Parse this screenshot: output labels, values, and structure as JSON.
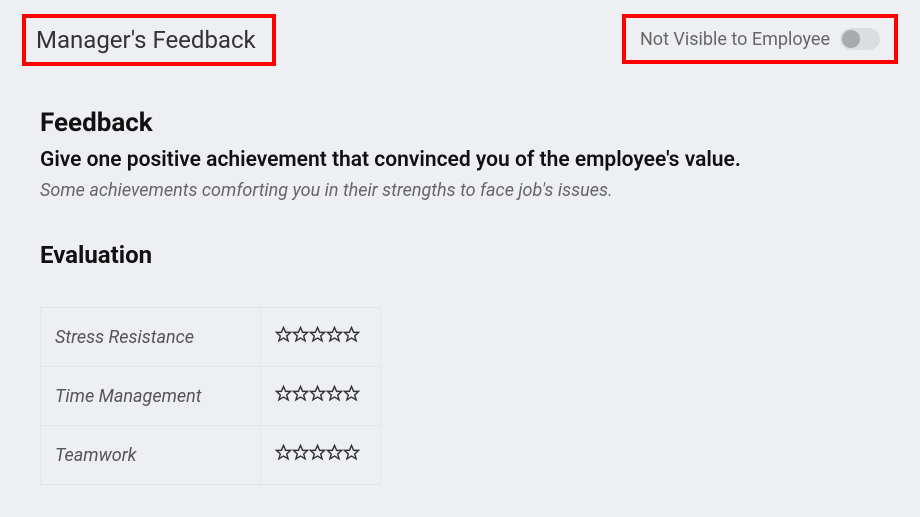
{
  "header": {
    "title": "Manager's Feedback",
    "visibility_label": "Not Visible to Employee",
    "visibility_on": false
  },
  "feedback": {
    "heading": "Feedback",
    "question": "Give one positive achievement that convinced you of the employee's value.",
    "hint": "Some achievements comforting you in their strengths to face job's issues."
  },
  "evaluation": {
    "heading": "Evaluation",
    "rows": [
      {
        "label": "Stress Resistance",
        "rating": 0
      },
      {
        "label": "Time Management",
        "rating": 0
      },
      {
        "label": "Teamwork",
        "rating": 0
      }
    ],
    "max_rating": 5
  },
  "colors": {
    "highlight_border": "#ff0000",
    "page_bg": "#edeff2"
  }
}
